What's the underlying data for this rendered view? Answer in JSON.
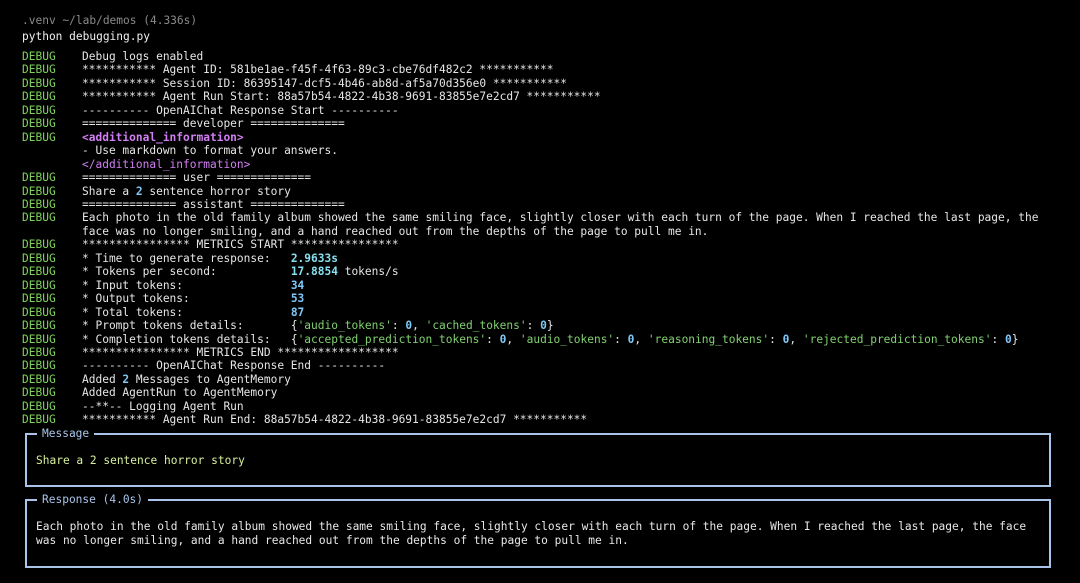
{
  "prompt": {
    "path": ".venv ~/lab/demos (4.336s)",
    "command": "python debugging.py"
  },
  "log_level": "DEBUG",
  "log": {
    "l1": "Debug logs enabled",
    "l2": "*********** Agent ID: 581be1ae-f45f-4f63-89c3-cbe76df482c2 ***********",
    "l3": "*********** Session ID: 86395147-dcf5-4b46-ab8d-af5a70d356e0 ***********",
    "l4": "*********** Agent Run Start: 88a57b54-4822-4b38-9691-83855e7e2cd7 ***********",
    "l5": "---------- OpenAIChat Response Start ----------",
    "l6": "============== developer ==============",
    "l7_open": "<additional_information>",
    "l7_line": "- Use markdown to format your answers.",
    "l7_close": "</additional_information>",
    "l8": "============== user ==============",
    "l9_pre": "Share a ",
    "l9_num": "2",
    "l9_post": " sentence horror story",
    "l10": "============== assistant ==============",
    "l11": "Each photo in the old family album showed the same smiling face, slightly closer with each turn of the page. When I reached the last page, the face was no longer smiling, and a hand reached out from the depths of the page to pull me in.",
    "l12": "**************** METRICS START ****************",
    "m_time_label": "* Time to generate response:   ",
    "m_time_val": "2.9633s",
    "m_tps_label": "* Tokens per second:           ",
    "m_tps_val": "17.8854",
    "m_tps_unit": " tokens/s",
    "m_in_label": "* Input tokens:                ",
    "m_in_val": "34",
    "m_out_label": "* Output tokens:               ",
    "m_out_val": "53",
    "m_tot_label": "* Total tokens:                ",
    "m_tot_val": "87",
    "m_pt_label": "* Prompt tokens details:       ",
    "m_pt_k1": "'audio_tokens'",
    "m_pt_v1": "0",
    "m_pt_k2": "'cached_tokens'",
    "m_pt_v2": "0",
    "m_ct_label": "* Completion tokens details:   ",
    "m_ct_k1": "'accepted_prediction_tokens'",
    "m_ct_v1": "0",
    "m_ct_k2": "'audio_tokens'",
    "m_ct_v2": "0",
    "m_ct_k3": "'reasoning_tokens'",
    "m_ct_v3": "0",
    "m_ct_k4": "'rejected_prediction_tokens'",
    "m_ct_v4": "0",
    "l13": "**************** METRICS END ******************",
    "l14": "---------- OpenAIChat Response End ----------",
    "l15_pre": "Added ",
    "l15_num": "2",
    "l15_post": " Messages to AgentMemory",
    "l16": "Added AgentRun to AgentMemory",
    "l17": "--**-- Logging Agent Run",
    "l18": "*********** Agent Run End: 88a57b54-4822-4b38-9691-83855e7e2cd7 ***********"
  },
  "message_panel": {
    "title": "Message",
    "body": "Share a 2 sentence horror story"
  },
  "response_panel": {
    "title": "Response (4.0s)",
    "body": "Each photo in the old family album showed the same smiling face, slightly closer with each turn of the page. When I reached the last page, the face was no longer smiling, and a hand reached out from the depths of the page to pull me in."
  },
  "colors": {
    "background": "#000000",
    "debug": "#7fd35b",
    "tag": "#d17ff2",
    "number": "#7ec8f7",
    "string": "#80d070",
    "panel_border": "#a9c4e8",
    "message_text": "#d8f09c"
  }
}
